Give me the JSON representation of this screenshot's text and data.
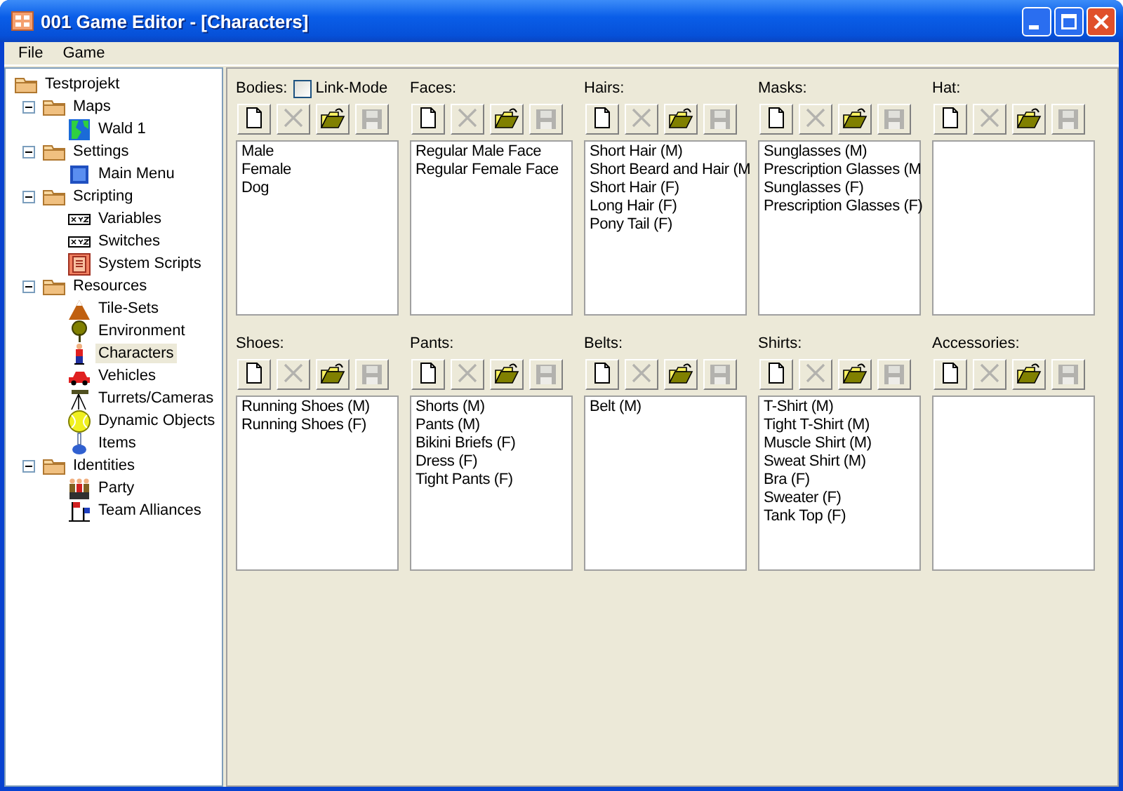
{
  "window": {
    "title": "001 Game Editor - [Characters]"
  },
  "menu": [
    "File",
    "Game"
  ],
  "tree": [
    {
      "label": "Testprojekt",
      "kind": "folder",
      "selected": false,
      "children": [
        {
          "label": "Maps",
          "kind": "folder",
          "selected": false,
          "expanded": true,
          "children": [
            {
              "label": "Wald 1",
              "kind": "map",
              "selected": false
            }
          ]
        },
        {
          "label": "Settings",
          "kind": "folder",
          "selected": false,
          "expanded": true,
          "children": [
            {
              "label": "Main Menu",
              "kind": "screen",
              "selected": false
            }
          ]
        },
        {
          "label": "Scripting",
          "kind": "folder",
          "selected": false,
          "expanded": true,
          "children": [
            {
              "label": "Variables",
              "kind": "xyz",
              "selected": false
            },
            {
              "label": "Switches",
              "kind": "xyz",
              "selected": false
            },
            {
              "label": "System Scripts",
              "kind": "scroll",
              "selected": false
            }
          ]
        },
        {
          "label": "Resources",
          "kind": "folder",
          "selected": false,
          "expanded": true,
          "children": [
            {
              "label": "Tile-Sets",
              "kind": "mountain",
              "selected": false
            },
            {
              "label": "Environment",
              "kind": "tree",
              "selected": false
            },
            {
              "label": "Characters",
              "kind": "person",
              "selected": true
            },
            {
              "label": "Vehicles",
              "kind": "car",
              "selected": false
            },
            {
              "label": "Turrets/Cameras",
              "kind": "tripod",
              "selected": false
            },
            {
              "label": "Dynamic Objects",
              "kind": "ball",
              "selected": false
            },
            {
              "label": "Items",
              "kind": "flask",
              "selected": false
            }
          ]
        },
        {
          "label": "Identities",
          "kind": "folder",
          "selected": false,
          "expanded": true,
          "children": [
            {
              "label": "Party",
              "kind": "group",
              "selected": false
            },
            {
              "label": "Team Alliances",
              "kind": "flags",
              "selected": false
            }
          ]
        }
      ]
    }
  ],
  "link_mode": {
    "label": "Link-Mode",
    "checked": false
  },
  "panels": [
    {
      "label": "Bodies:",
      "items": [
        "Male",
        "Female",
        "Dog"
      ]
    },
    {
      "label": "Faces:",
      "items": [
        "Regular Male Face",
        "Regular Female Face"
      ]
    },
    {
      "label": "Hairs:",
      "items": [
        "Short Hair (M)",
        "Short Beard and Hair (M",
        "Short Hair (F)",
        "Long Hair (F)",
        "Pony Tail (F)"
      ]
    },
    {
      "label": "Masks:",
      "items": [
        "Sunglasses (M)",
        "Prescription Glasses (M",
        "Sunglasses (F)",
        "Prescription Glasses (F)"
      ]
    },
    {
      "label": "Hat:"
    },
    {
      "label": "Shoes:",
      "items": [
        "Running Shoes (M)",
        "Running Shoes (F)"
      ]
    },
    {
      "label": "Pants:",
      "items": [
        "Shorts (M)",
        "Pants (M)",
        "Bikini Briefs (F)",
        "Dress (F)",
        "Tight Pants (F)"
      ]
    },
    {
      "label": "Belts:",
      "items": [
        "Belt (M)"
      ]
    },
    {
      "label": "Shirts:",
      "items": [
        "T-Shirt (M)",
        "Tight T-Shirt (M)",
        "Muscle Shirt (M)",
        "Sweat Shirt (M)",
        "Bra (F)",
        "Sweater (F)",
        "Tank Top (F)"
      ]
    },
    {
      "label": "Accessories:"
    }
  ],
  "toolbar": [
    {
      "kind": "new",
      "disabled": false
    },
    {
      "kind": "delete",
      "disabled": true
    },
    {
      "kind": "open",
      "disabled": false
    },
    {
      "kind": "save",
      "disabled": true
    }
  ]
}
